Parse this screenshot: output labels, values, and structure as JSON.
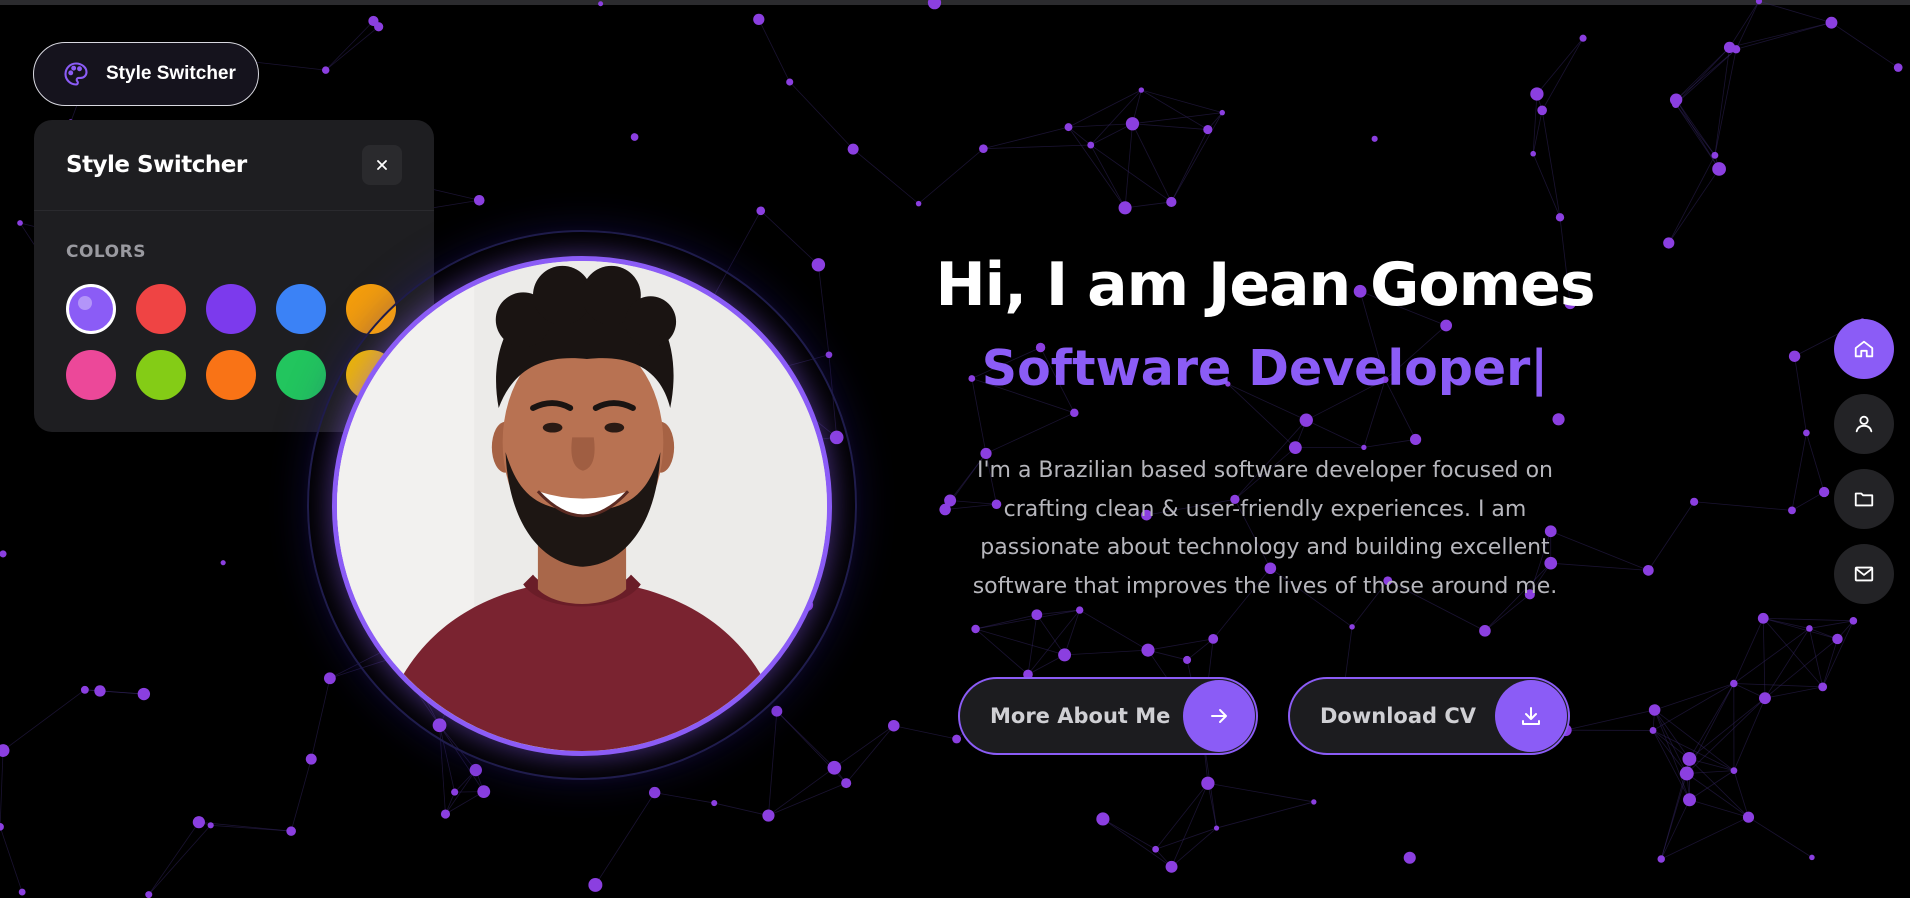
{
  "switcher": {
    "toggle_label": "Style Switcher",
    "panel_title": "Style Switcher",
    "colors_label": "COLORS",
    "colors": [
      {
        "name": "violet",
        "hex": "#8b5cf6",
        "active": true
      },
      {
        "name": "red",
        "hex": "#ef4444",
        "active": false
      },
      {
        "name": "purple",
        "hex": "#7c3aed",
        "active": false
      },
      {
        "name": "blue",
        "hex": "#3b82f6",
        "active": false
      },
      {
        "name": "amber",
        "hex": "#f59e0b",
        "active": false
      },
      {
        "name": "pink",
        "hex": "#ec4899",
        "active": false
      },
      {
        "name": "lime",
        "hex": "#84cc16",
        "active": false
      },
      {
        "name": "orange",
        "hex": "#f97316",
        "active": false
      },
      {
        "name": "green",
        "hex": "#22c55e",
        "active": false
      },
      {
        "name": "yellow",
        "hex": "#eab308",
        "active": false
      }
    ]
  },
  "hero": {
    "title": "Hi, I am Jean Gomes",
    "role": "Software Developer",
    "caret": "|",
    "description": "I'm a Brazilian based software developer focused on crafting clean & user-friendly experiences. I am passionate about technology and building excellent software that improves the lives of those around me.",
    "more_button": "More About Me",
    "cv_button": "Download CV"
  },
  "side_nav": [
    {
      "name": "home",
      "icon": "home-icon",
      "active": true
    },
    {
      "name": "about",
      "icon": "user-icon",
      "active": false
    },
    {
      "name": "portfolio",
      "icon": "folder-icon",
      "active": false
    },
    {
      "name": "contact",
      "icon": "mail-icon",
      "active": false
    }
  ],
  "colors": {
    "accent": "#8b5cf6",
    "background": "#000000",
    "panel": "#1e1e21"
  }
}
